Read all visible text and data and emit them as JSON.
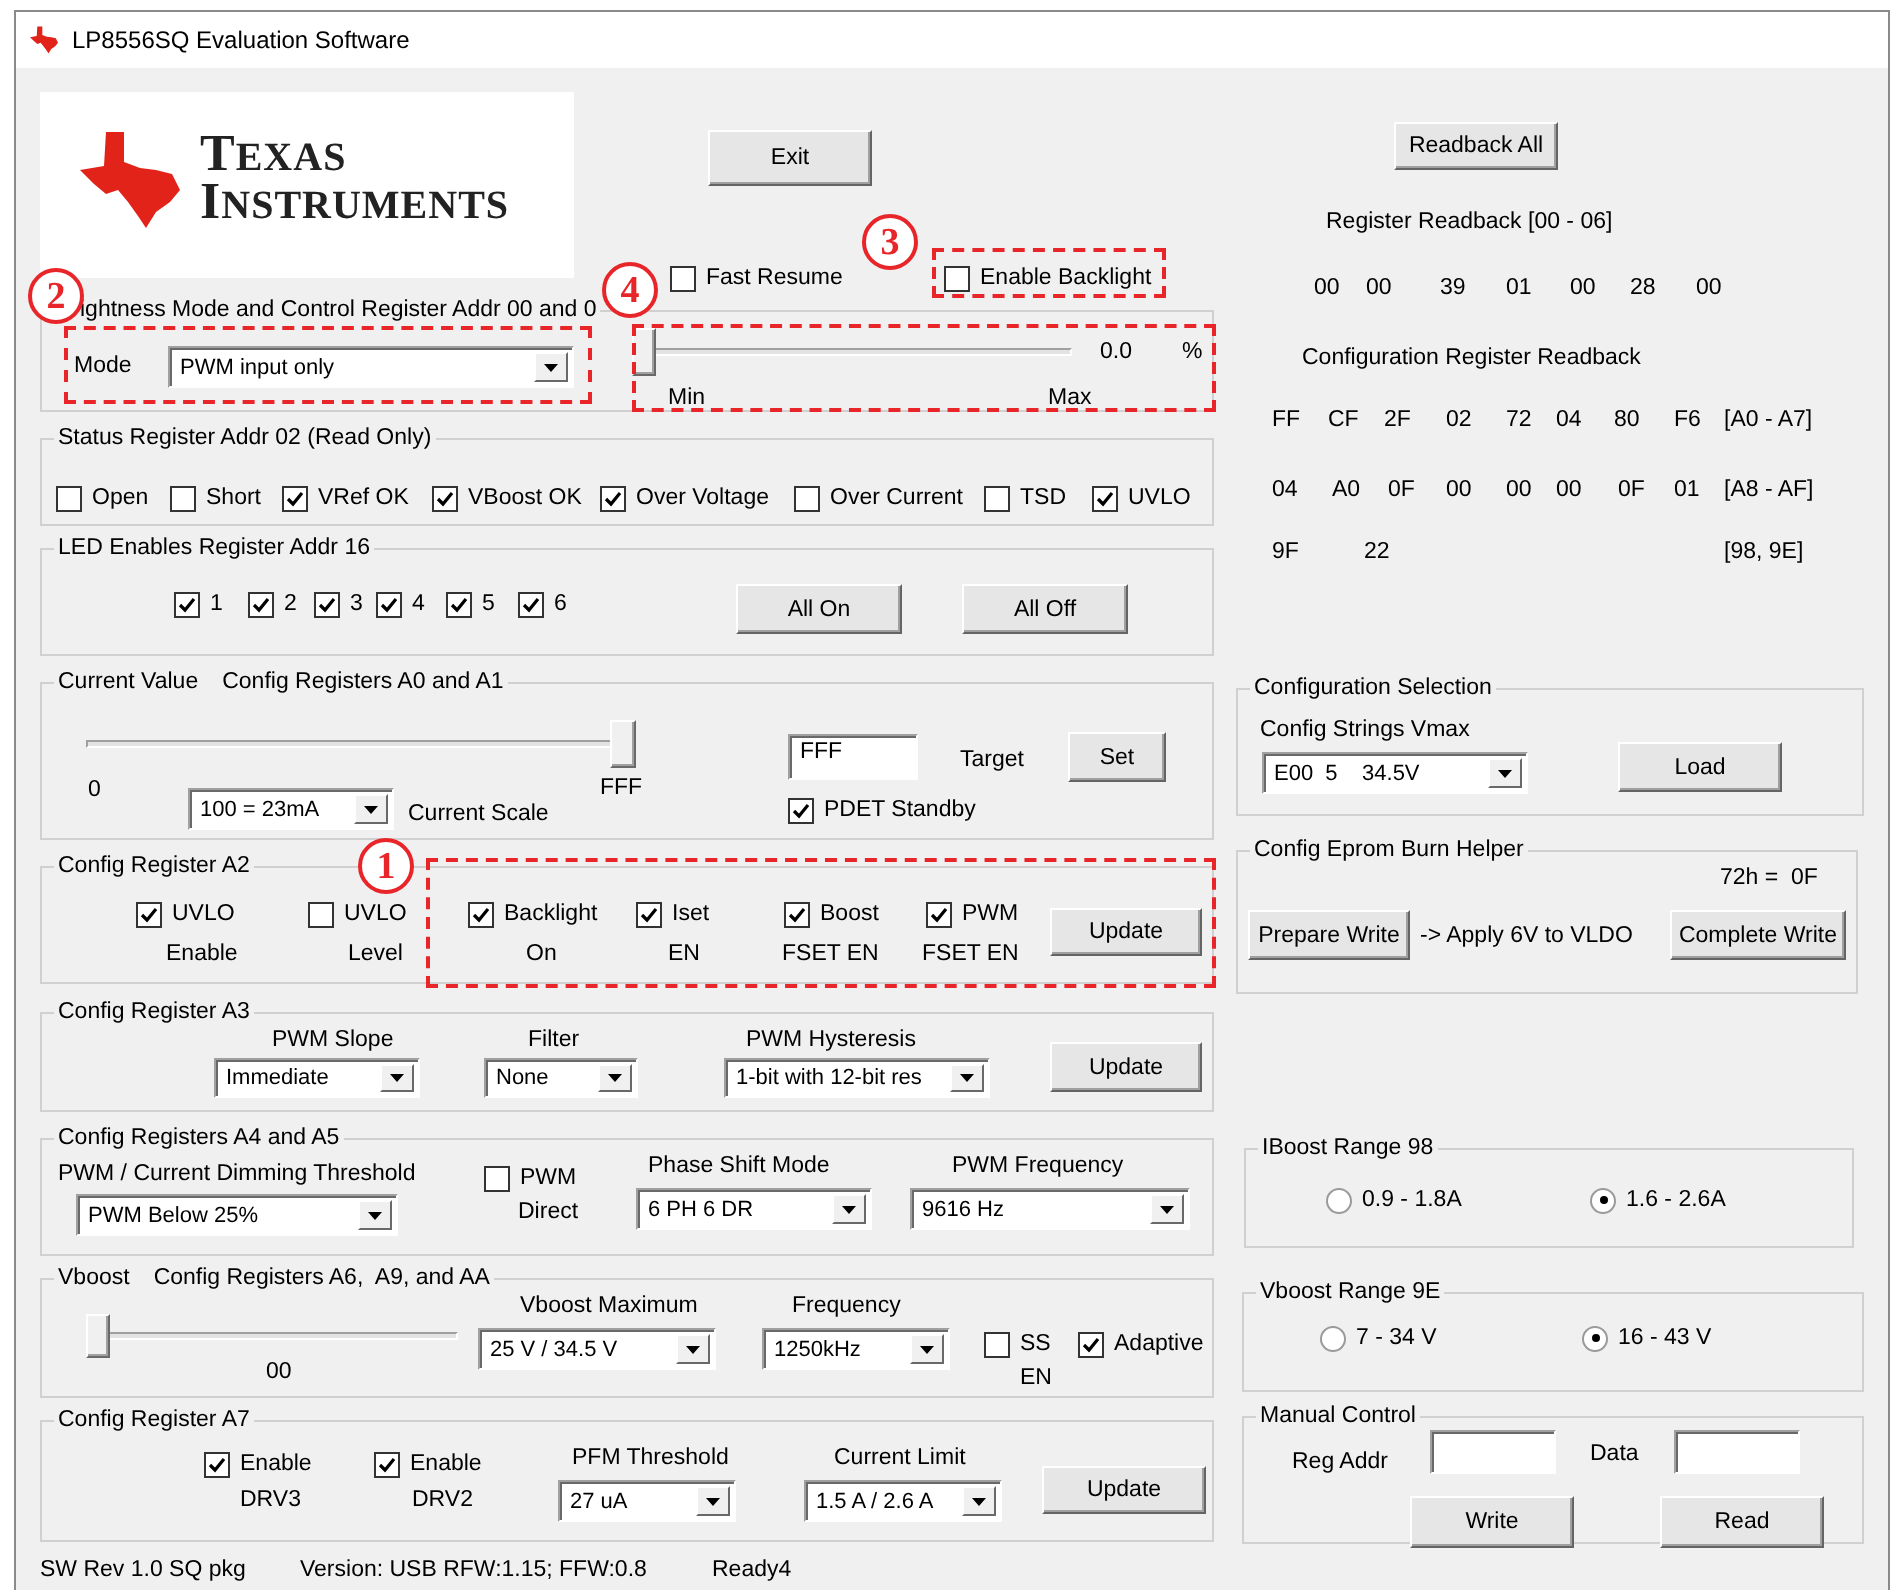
{
  "window": {
    "title": "LP8556SQ Evaluation Software"
  },
  "logo": {
    "line1": "TEXAS",
    "line2": "INSTRUMENTS"
  },
  "exit_button": "Exit",
  "fast_resume": {
    "label": "Fast Resume",
    "checked": false
  },
  "enable_backlight": {
    "label": "Enable Backlight",
    "checked": false
  },
  "brightness": {
    "title": "ightness Mode and Control Register Addr 00 and 0",
    "mode_label": "Mode",
    "mode": "PWM input only",
    "slider": {
      "level": 0
    },
    "reading": "0.0",
    "unit": "%",
    "min_label": "Min",
    "max_label": "Max"
  },
  "status": {
    "title": "Status Register Addr 02 (Read Only)",
    "flags": [
      {
        "label": "Open",
        "checked": false
      },
      {
        "label": "Short",
        "checked": false
      },
      {
        "label": "VRef OK",
        "checked": true
      },
      {
        "label": "VBoost OK",
        "checked": true
      },
      {
        "label": "Over Voltage",
        "checked": true
      },
      {
        "label": "Over Current",
        "checked": false
      },
      {
        "label": "TSD",
        "checked": false
      },
      {
        "label": "UVLO",
        "checked": true
      }
    ]
  },
  "led_enables": {
    "title": "LED Enables Register Addr 16",
    "leds": [
      {
        "label": "1",
        "checked": true
      },
      {
        "label": "2",
        "checked": true
      },
      {
        "label": "3",
        "checked": true
      },
      {
        "label": "4",
        "checked": true
      },
      {
        "label": "5",
        "checked": true
      },
      {
        "label": "6",
        "checked": true
      }
    ],
    "buttons": [
      "All On",
      "All Off"
    ]
  },
  "current_value": {
    "title": [
      "Current Value",
      "Config Registers A0 and A1"
    ],
    "slider": {
      "level": 1
    },
    "min_label": "0",
    "max_label": "FFF",
    "scale": "100 = 23mA",
    "scale_label": "Current Scale",
    "target_value": "FFF",
    "target_label": "Target",
    "set_button": "Set",
    "pdet_standby": {
      "label": "PDET Standby",
      "checked": true
    }
  },
  "reg_a2": {
    "title": "Config Register A2",
    "options": [
      {
        "label": "UVLO",
        "sublabel": "Enable",
        "checked": true
      },
      {
        "label": "UVLO",
        "sublabel": "Level",
        "checked": false
      },
      {
        "label": "Backlight",
        "sublabel": "On",
        "checked": true
      },
      {
        "label": "Iset",
        "sublabel": "EN",
        "checked": true
      },
      {
        "label": "Boost",
        "sublabel": "FSET EN",
        "checked": true
      },
      {
        "label": "PWM",
        "sublabel": "FSET EN",
        "checked": true
      }
    ],
    "update_button": "Update"
  },
  "reg_a3": {
    "title": "Config Register A3",
    "selects": [
      {
        "label": "PWM Slope",
        "value": "Immediate"
      },
      {
        "label": "Filter",
        "value": "None"
      },
      {
        "label": "PWM Hysteresis",
        "value": "1-bit with 12-bit res"
      }
    ],
    "update_button": "Update"
  },
  "reg_a4_a5": {
    "title": "Config Registers A4 and A5",
    "threshold": {
      "label": "PWM / Current Dimming Threshold",
      "value": "PWM Below 25%"
    },
    "pwm_direct": {
      "label": "PWM",
      "sublabel": "Direct",
      "checked": false
    },
    "phase_shift": {
      "label": "Phase Shift Mode",
      "value": "6 PH 6 DR"
    },
    "pwm_frequency": {
      "label": "PWM Frequency",
      "value": "9616 Hz"
    }
  },
  "vboost": {
    "title": [
      "Vboost",
      "Config Registers A6,  A9, and AA"
    ],
    "slider": {
      "level": 0
    },
    "reading": "00",
    "maximum": {
      "label": "Vboost Maximum",
      "value": "25 V / 34.5 V"
    },
    "frequency": {
      "label": "Frequency",
      "value": "1250kHz"
    },
    "ss_en": {
      "label": "SS",
      "sublabel": "EN",
      "checked": false
    },
    "adaptive": {
      "label": "Adaptive",
      "checked": true
    }
  },
  "reg_a7": {
    "title": "Config Register A7",
    "drives": [
      {
        "label": "Enable",
        "sublabel": "DRV3",
        "checked": true
      },
      {
        "label": "Enable",
        "sublabel": "DRV2",
        "checked": true
      }
    ],
    "pfm_threshold": {
      "label": "PFM Threshold",
      "value": "27 uA"
    },
    "current_limit": {
      "label": "Current Limit",
      "value": "1.5 A / 2.6 A"
    },
    "update_button": "Update"
  },
  "status_bar": [
    "SW Rev 1.0 SQ pkg",
    "Version: USB RFW:1.15; FFW:0.8",
    "Ready4"
  ],
  "readback": {
    "button": "Readback All",
    "register_title": "Register Readback [00 - 06]",
    "register_values": [
      "00",
      "00",
      "39",
      "01",
      "00",
      "28",
      "00"
    ],
    "config_title": "Configuration Register Readback",
    "config_rows": [
      {
        "values": [
          "FF",
          "CF",
          "2F",
          "02",
          "72",
          "04",
          "80",
          "F6"
        ],
        "range": "[A0 - A7]"
      },
      {
        "values": [
          "04",
          "A0",
          "0F",
          "00",
          "00",
          "00",
          "0F",
          "01"
        ],
        "range": "[A8 - AF]"
      },
      {
        "values": [
          "9F",
          "22"
        ],
        "range": "[98, 9E]"
      }
    ]
  },
  "config_selection": {
    "title": "Configuration Selection",
    "label": "Config Strings Vmax",
    "value": "E00  5    34.5V",
    "load_button": "Load"
  },
  "eprom": {
    "title": "Config Eprom Burn Helper",
    "status": "72h =  0F",
    "prepare_button": "Prepare Write",
    "hint": "-> Apply 6V to VLDO",
    "complete_button": "Complete Write"
  },
  "iboost_range": {
    "title": "IBoost Range 98",
    "options": [
      {
        "label": "0.9 - 1.8A",
        "selected": false
      },
      {
        "label": "1.6 - 2.6A",
        "selected": true
      }
    ]
  },
  "vboost_range": {
    "title": "Vboost Range 9E",
    "options": [
      {
        "label": "7 - 34 V",
        "selected": false
      },
      {
        "label": "16 - 43 V",
        "selected": true
      }
    ]
  },
  "manual_control": {
    "title": "Manual Control",
    "reg_addr_label": "Reg Addr",
    "data_label": "Data",
    "write_button": "Write",
    "read_button": "Read"
  },
  "annotations": [
    {
      "number": "1"
    },
    {
      "number": "2"
    },
    {
      "number": "3"
    },
    {
      "number": "4"
    }
  ]
}
